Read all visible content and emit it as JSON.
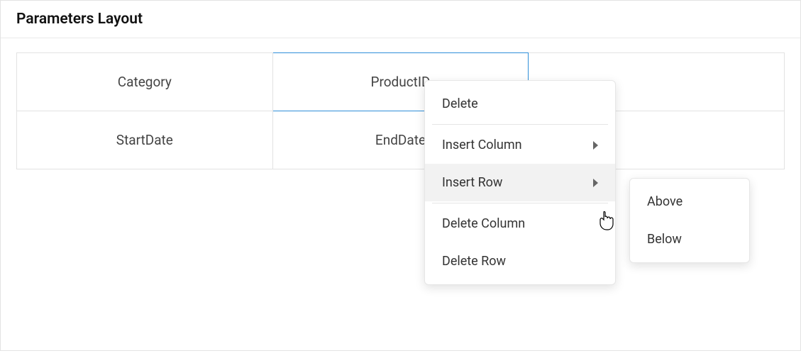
{
  "panel": {
    "title": "Parameters Layout"
  },
  "grid": {
    "rows": [
      [
        "Category",
        "ProductID",
        ""
      ],
      [
        "StartDate",
        "EndDate",
        ""
      ]
    ],
    "selected": {
      "row": 0,
      "col": 1
    }
  },
  "contextMenu": {
    "items": {
      "delete": "Delete",
      "insertColumn": "Insert Column",
      "insertRow": "Insert Row",
      "deleteColumn": "Delete Column",
      "deleteRow": "Delete Row"
    }
  },
  "submenu": {
    "above": "Above",
    "below": "Below"
  }
}
